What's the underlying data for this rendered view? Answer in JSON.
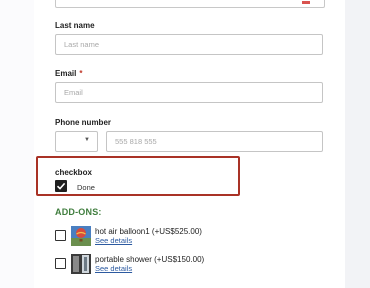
{
  "form": {
    "last_name": {
      "label": "Last name",
      "placeholder": "Last name",
      "value": ""
    },
    "email": {
      "label": "Email",
      "required_mark": "*",
      "placeholder": "Email",
      "value": ""
    },
    "phone": {
      "label": "Phone number",
      "country_select": {
        "selected": ""
      },
      "placeholder": "555 818 555",
      "value": ""
    },
    "checkbox_field": {
      "title": "checkbox",
      "option_label": "Done",
      "checked": true
    }
  },
  "addons": {
    "title": "ADD-ONS:",
    "items": [
      {
        "name": "hot air balloon1 (+US$525.00)",
        "link": "See details",
        "checked": false,
        "image_icon": "balloon-thumbnail-icon"
      },
      {
        "name": "portable shower (+US$150.00)",
        "link": "See details",
        "checked": false,
        "image_icon": "shower-thumbnail-icon"
      }
    ]
  },
  "colors": {
    "accent_border": "#a93226",
    "addons_title": "#3f7d3d",
    "link": "#2c5aa0",
    "required": "#c0392b"
  }
}
